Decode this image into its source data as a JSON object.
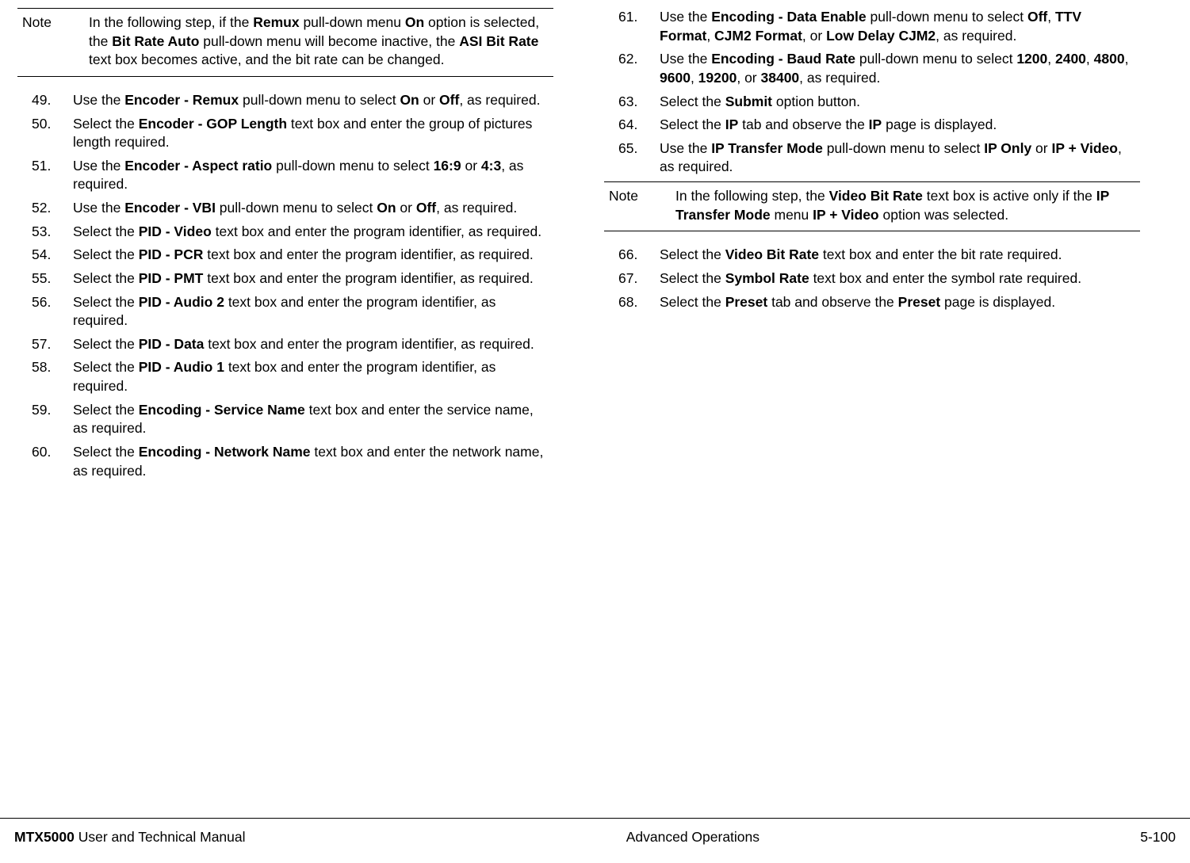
{
  "left_note": {
    "label": "Note",
    "plain1": "In the following step, if the ",
    "b1": "Remux",
    "plain2": " pull-down menu ",
    "b2": "On",
    "plain3": " option is selected, the ",
    "b3": "Bit Rate Auto",
    "plain4": " pull-down menu will become inactive, the ",
    "b4": "ASI Bit Rate",
    "plain5": " text box becomes active, and the bit rate can be changed."
  },
  "left_steps": [
    {
      "n": "49.",
      "p1": "Use the ",
      "b1": "Encoder - Remux",
      "p2": " pull-down menu to select ",
      "b2": "On",
      "p3": " or ",
      "b3": "Off",
      "p4": ", as required."
    },
    {
      "n": "50.",
      "p1": "Select the ",
      "b1": "Encoder - GOP Length",
      "p2": " text box and enter the group of pictures length required."
    },
    {
      "n": "51.",
      "p1": "Use the ",
      "b1": "Encoder - Aspect ratio",
      "p2": " pull-down menu to select ",
      "b2": "16:9",
      "p3": " or ",
      "b3": "4:3",
      "p4": ", as required."
    },
    {
      "n": "52.",
      "p1": "Use the ",
      "b1": "Encoder - VBI",
      "p2": " pull-down menu to select ",
      "b2": "On",
      "p3": " or ",
      "b3": "Off",
      "p4": ", as required."
    },
    {
      "n": "53.",
      "p1": "Select the ",
      "b1": "PID - Video",
      "p2": " text box and enter the program identifier, as required."
    },
    {
      "n": "54.",
      "p1": "Select the ",
      "b1": "PID - PCR",
      "p2": " text box and enter the program identifier, as required."
    },
    {
      "n": "55.",
      "p1": "Select the ",
      "b1": "PID - PMT",
      "p2": " text box and enter the program identifier, as required."
    },
    {
      "n": "56.",
      "p1": "Select the ",
      "b1": "PID - Audio 2",
      "p2": " text box and enter the program identifier, as required."
    },
    {
      "n": "57.",
      "p1": "Select the ",
      "b1": "PID - Data",
      "p2": " text box and enter the program identifier, as required."
    },
    {
      "n": "58.",
      "p1": "Select the ",
      "b1": "PID - Audio 1",
      "p2": " text box and enter the program identifier, as required."
    },
    {
      "n": "59.",
      "p1": "Select the ",
      "b1": "Encoding - Service Name",
      "p2": " text box and enter the service name, as required."
    },
    {
      "n": "60.",
      "p1": "Select the ",
      "b1": "Encoding - Network Name",
      "p2": " text box and enter the network name, as required."
    }
  ],
  "right_steps_a": [
    {
      "n": "61.",
      "p1": "Use the ",
      "b1": "Encoding - Data Enable",
      "p2": " pull-down menu to select ",
      "b2": "Off",
      "p3": ", ",
      "b3": "TTV Format",
      "p4": ", ",
      "b4": "CJM2 Format",
      "p5": ", or ",
      "b5": "Low Delay CJM2",
      "p6": ", as required."
    },
    {
      "n": "62.",
      "p1": "Use the ",
      "b1": "Encoding - Baud Rate",
      "p2": " pull-down menu to select ",
      "b2": "1200",
      "p3": ", ",
      "b3": "2400",
      "p4": ", ",
      "b4": "4800",
      "p5": ", ",
      "b5": "9600",
      "p6": ", ",
      "b6": "19200",
      "p7": ", or ",
      "b7": "38400",
      "p8": ", as required."
    },
    {
      "n": "63.",
      "p1": "Select the ",
      "b1": "Submit",
      "p2": " option button."
    },
    {
      "n": "64.",
      "p1": "Select the ",
      "b1": "IP",
      "p2": " tab and observe the ",
      "b2": "IP",
      "p3": " page is displayed."
    },
    {
      "n": "65.",
      "p1": "Use the ",
      "b1": "IP Transfer Mode",
      "p2": " pull-down menu to select ",
      "b2": "IP Only",
      "p3": " or ",
      "b3": "IP + Video",
      "p4": ", as required."
    }
  ],
  "right_note": {
    "label": "Note",
    "plain1": "In the following step, the ",
    "b1": "Video Bit Rate",
    "plain2": " text box is active only if the ",
    "b2": "IP Transfer Mode",
    "plain3": " menu ",
    "b3": "IP + Video",
    "plain4": " option was selected."
  },
  "right_steps_b": [
    {
      "n": "66.",
      "p1": "Select the ",
      "b1": "Video Bit Rate",
      "p2": " text box and enter the bit rate required."
    },
    {
      "n": "67.",
      "p1": "Select the ",
      "b1": "Symbol Rate",
      "p2": " text box and enter the symbol rate required."
    },
    {
      "n": "68.",
      "p1": "Select the ",
      "b1": "Preset",
      "p2": " tab and observe the ",
      "b2": "Preset",
      "p3": " page is displayed."
    }
  ],
  "footer": {
    "left_b": "MTX5000",
    "left_plain": " User and Technical Manual",
    "center": "Advanced Operations",
    "right": "5-100"
  }
}
